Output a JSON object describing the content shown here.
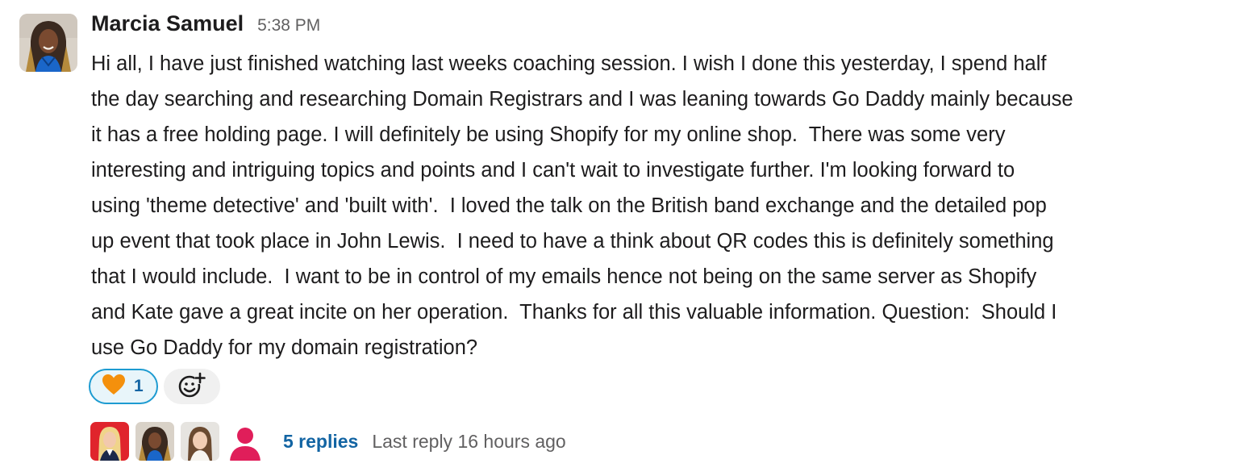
{
  "message": {
    "sender": "Marcia Samuel",
    "time": "5:38 PM",
    "body_lines": [
      "Hi all, I have just finished watching last weeks coaching session. I wish I done this yesterday, I spend half",
      "the day searching and researching Domain Registrars and I was leaning towards Go Daddy mainly because",
      "it has a free holding page. I will definitely be using Shopify for my online shop.  There was some very",
      "interesting and intriguing topics and points and I can't wait to investigate further. I'm looking forward to",
      "using 'theme detective' and 'built with'.  I loved the talk on the British band exchange and the detailed pop",
      "up event that took place in John Lewis.  I need to have a think about QR codes this is definitely something",
      "that I would include.  I want to be in control of my emails hence not being on the same server as Shopify",
      "and Kate gave a great incite on her operation.  Thanks for all this valuable information. Question:  Should I",
      "use Go Daddy for my domain registration?"
    ]
  },
  "reactions": [
    {
      "emoji": "orange-heart-icon",
      "count": "1",
      "color": "#f4900c"
    }
  ],
  "thread": {
    "replies_label": "5 replies",
    "last_reply": "Last reply 16 hours ago"
  },
  "colors": {
    "link": "#1264a3",
    "muted": "#616061",
    "reaction_border": "#1d9bd1",
    "reaction_bg": "#e8f5fa",
    "default_avatar": "#e01e5a"
  }
}
